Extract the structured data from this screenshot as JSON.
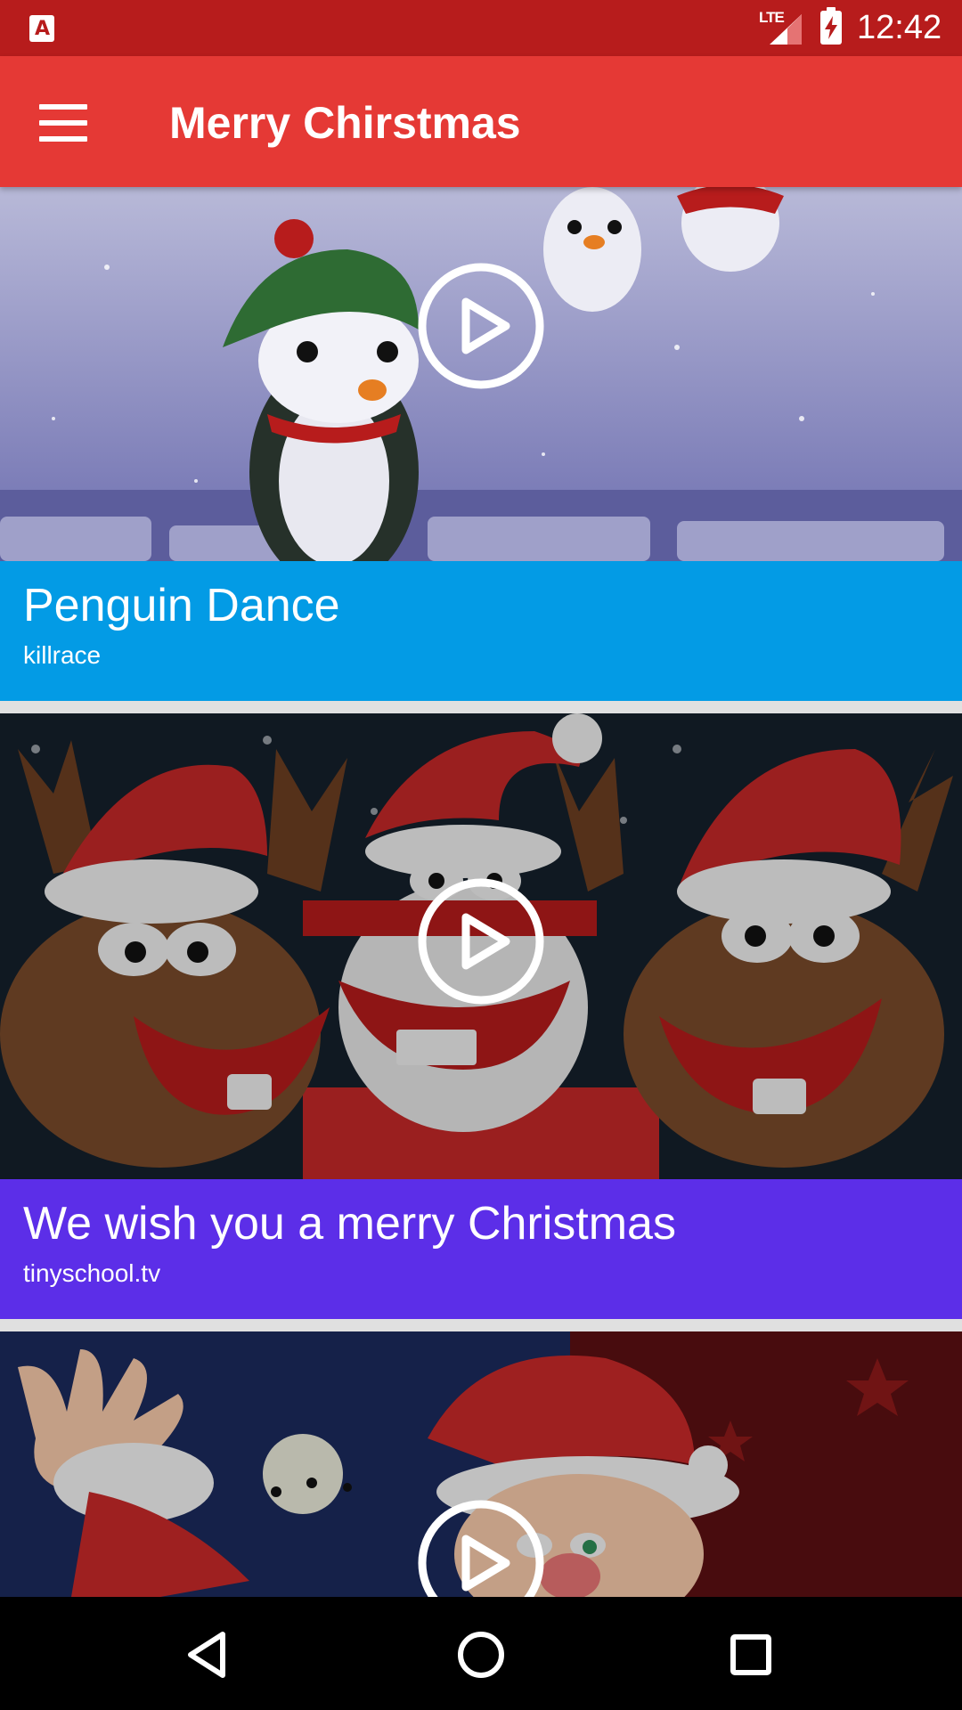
{
  "status_bar": {
    "time": "12:42",
    "network": "LTE",
    "app_icon_letter": "A"
  },
  "app_bar": {
    "title": "Merry Chirstmas",
    "menu_icon": "hamburger-menu-icon",
    "color": "#e53935"
  },
  "videos": [
    {
      "title": "Penguin Dance",
      "channel": "killrace",
      "caption_color": "#039be5"
    },
    {
      "title": "We wish you a merry Christmas",
      "channel": "tinyschool.tv",
      "caption_color": "#5c2ee8"
    },
    {
      "title": "",
      "channel": ""
    }
  ],
  "nav_bar": {
    "back_icon": "back-triangle-icon",
    "home_icon": "home-circle-icon",
    "recents_icon": "recents-square-icon"
  }
}
